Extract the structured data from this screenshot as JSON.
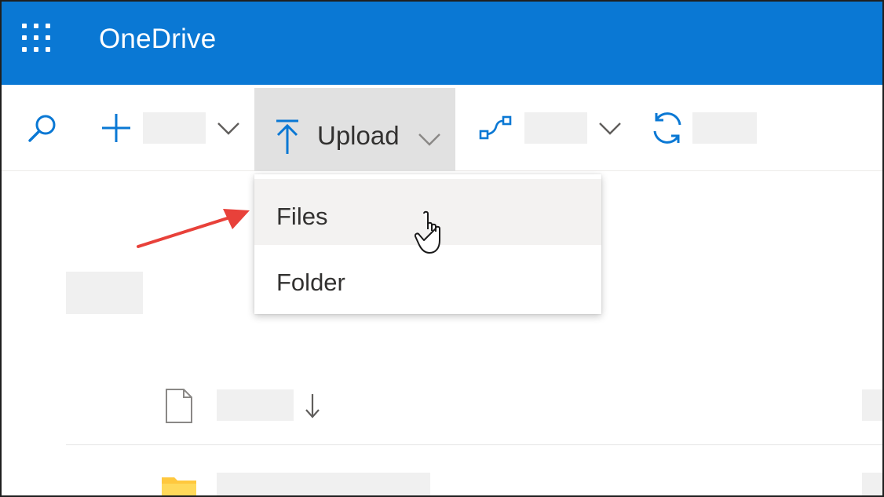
{
  "header": {
    "app_title": "OneDrive",
    "background_color": "#0a78d4",
    "app_launcher_icon": "waffle-icon"
  },
  "command_bar": {
    "search_icon": "search-icon",
    "new_icon": "plus-icon",
    "upload_label": "Upload",
    "upload_icon": "upload-arrow-icon",
    "sync_icon": "sync-icon",
    "flow_icon": "flow-icon",
    "accent_color": "#0a78d4"
  },
  "upload_menu": {
    "items": [
      {
        "label": "Files",
        "highlighted": true
      },
      {
        "label": "Folder",
        "highlighted": false
      }
    ]
  },
  "annotation": {
    "arrow_color": "#e8413a"
  }
}
